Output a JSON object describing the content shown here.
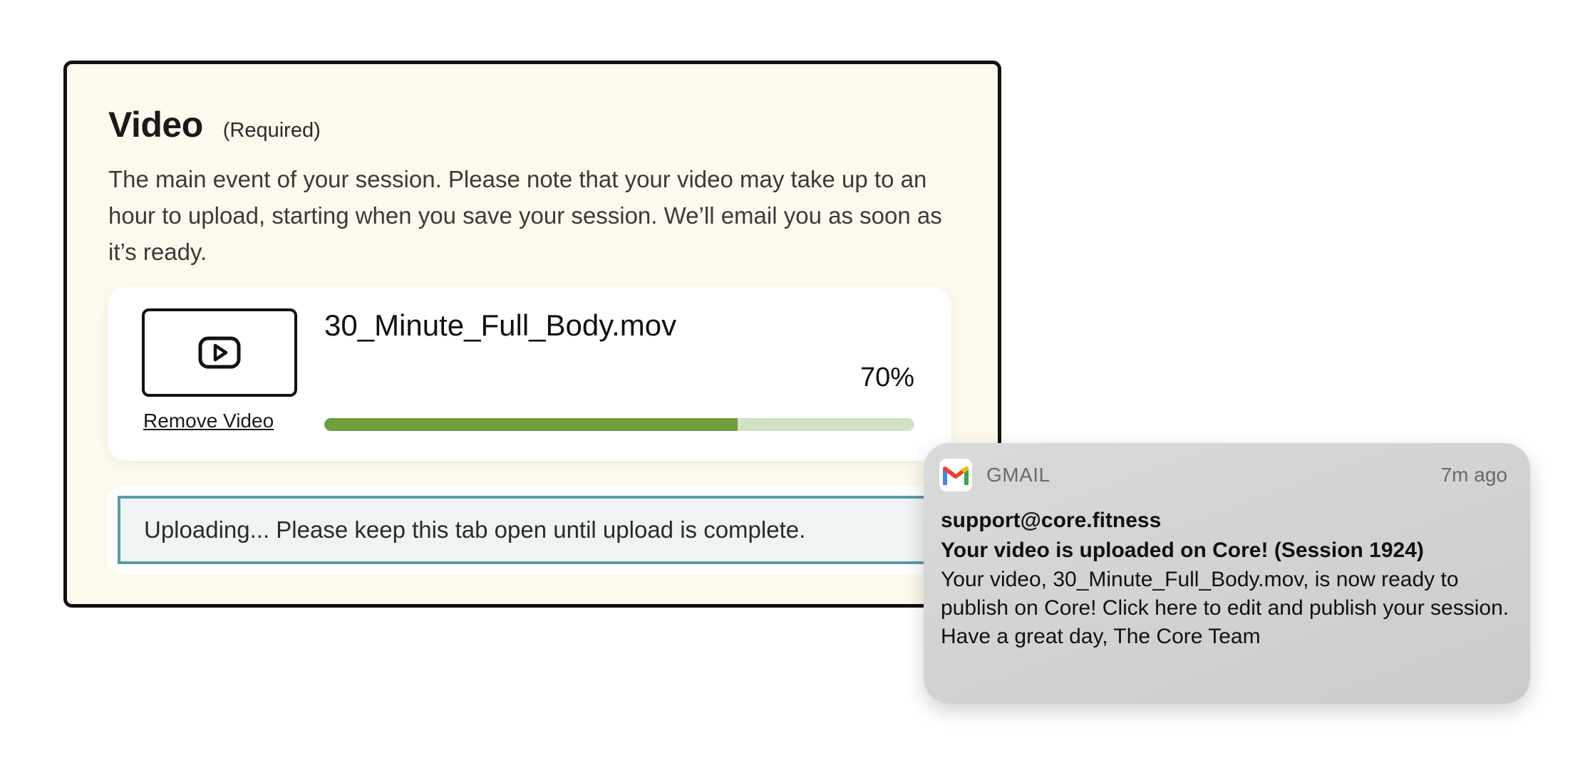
{
  "video_section": {
    "title": "Video",
    "required_label": "(Required)",
    "description": "The main event of your session. Please note that your video may take up to an hour to upload, starting when you save your session. We’ll email you as soon as it’s ready.",
    "file": {
      "name": "30_Minute_Full_Body.mov",
      "progress_percent": 70,
      "progress_label": "70%",
      "remove_label": "Remove Video",
      "thumbnail_icon": "play-icon"
    },
    "status_message": "Uploading... Please keep this tab open until upload is complete."
  },
  "notification": {
    "app_icon": "gmail-icon",
    "app_name": "GMAIL",
    "time": "7m ago",
    "from": "support@core.fitness",
    "subject": "Your video is uploaded on Core! (Session 1924)",
    "body": "Your video, 30_Minute_Full_Body.mov, is now ready to publish on Core! Click here to edit and publish your session. Have a great day, The Core Team"
  },
  "colors": {
    "card_background": "#fdf9ec",
    "progress_fill": "#6e9e3e",
    "progress_track": "#d2e3c4",
    "status_border": "#5e9aa8",
    "status_background": "#eef4f4",
    "notification_background": "#d2d4d5"
  }
}
